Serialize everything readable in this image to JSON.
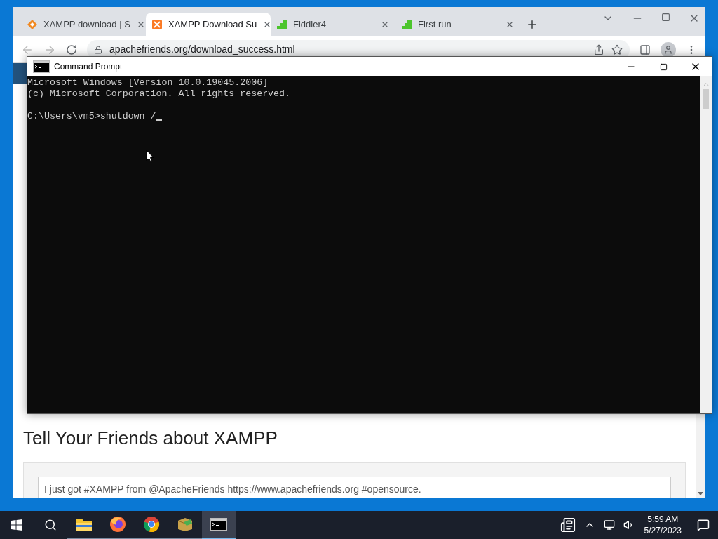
{
  "browser": {
    "tabs": [
      {
        "kind": "diamond",
        "title": "XAMPP download | S",
        "selected": false
      },
      {
        "kind": "square",
        "title": "XAMPP Download Su",
        "selected": true
      },
      {
        "kind": "fiddler",
        "title": "Fiddler4",
        "selected": false
      },
      {
        "kind": "fiddler",
        "title": "First run",
        "selected": false
      }
    ],
    "url": "apachefriends.org/download_success.html",
    "page": {
      "heading": "Tell Your Friends about XAMPP",
      "share_text": "I just got #XAMPP from @ApacheFriends https://www.apachefriends.org #opensource."
    }
  },
  "console": {
    "title": "Command Prompt",
    "output": [
      "Microsoft Windows [Version 10.0.19045.2006]",
      "(c) Microsoft Corporation. All rights reserved."
    ],
    "prompt": "C:\\Users\\vm5>shutdown /"
  },
  "taskbar": {
    "apps": [
      {
        "kind": "explorer",
        "selected": false
      },
      {
        "kind": "firefox",
        "selected": false
      },
      {
        "kind": "chrome",
        "selected": false
      },
      {
        "kind": "package",
        "selected": false
      },
      {
        "kind": "console",
        "selected": true
      }
    ],
    "time": "5:59 AM",
    "date": "5/27/2023"
  }
}
